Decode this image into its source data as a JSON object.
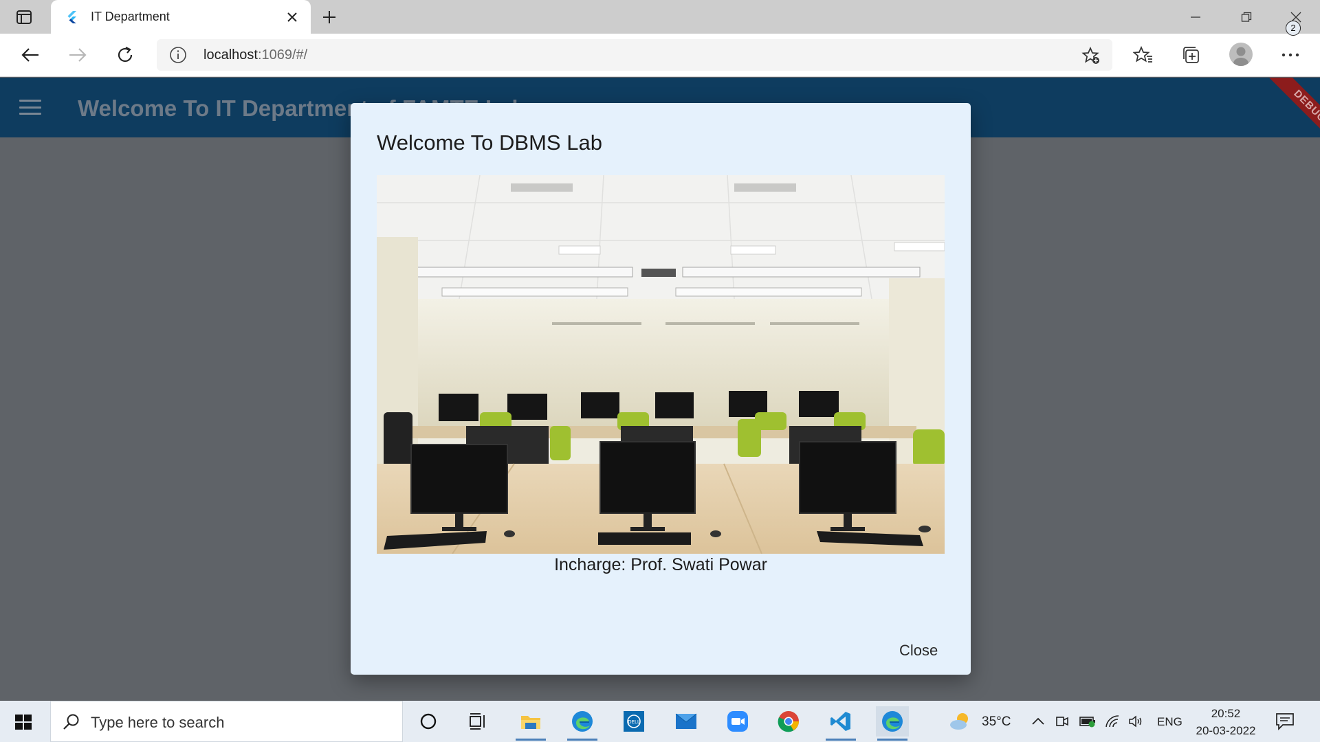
{
  "browser": {
    "tab_title": "IT Department",
    "url_host": "localhost",
    "url_rest": ":1069/#/"
  },
  "app": {
    "title": "Welcome To IT Department of FAMTE Lab",
    "debug_label": "DEBUG"
  },
  "dialog": {
    "title": "Welcome To DBMS Lab",
    "caption": "Incharge: Prof. Swati Powar",
    "close_label": "Close"
  },
  "taskbar": {
    "search_placeholder": "Type here to search",
    "weather": "35°C",
    "language": "ENG",
    "time": "20:52",
    "date": "20-03-2022",
    "notification_count": "2"
  },
  "colors": {
    "app_bar": "#0e3c5f",
    "dialog_bg": "#e5f1fc",
    "overlay": "#5f6368",
    "debug_ribbon": "#8c1c1c"
  }
}
